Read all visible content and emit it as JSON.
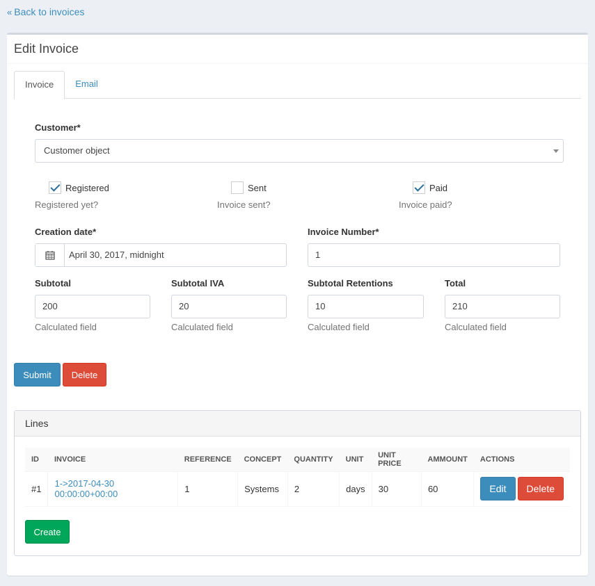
{
  "nav": {
    "back_label": "Back to invoices"
  },
  "box": {
    "title": "Edit Invoice"
  },
  "tabs": [
    {
      "label": "Invoice",
      "active": true
    },
    {
      "label": "Email",
      "active": false
    }
  ],
  "form": {
    "customer": {
      "label": "Customer*",
      "value": "Customer object"
    },
    "registered": {
      "label": "Registered",
      "checked": true,
      "help": "Registered yet?"
    },
    "sent": {
      "label": "Sent",
      "checked": false,
      "help": "Invoice sent?"
    },
    "paid": {
      "label": "Paid",
      "checked": true,
      "help": "Invoice paid?"
    },
    "creation_date": {
      "label": "Creation date*",
      "value": "April 30, 2017, midnight",
      "icon": "calendar-icon"
    },
    "invoice_number": {
      "label": "Invoice Number*",
      "value": "1"
    },
    "subtotal": {
      "label": "Subtotal",
      "value": "200",
      "help": "Calculated field"
    },
    "subtotal_iva": {
      "label": "Subtotal IVA",
      "value": "20",
      "help": "Calculated field"
    },
    "subtotal_retentions": {
      "label": "Subtotal Retentions",
      "value": "10",
      "help": "Calculated field"
    },
    "total": {
      "label": "Total",
      "value": "210",
      "help": "Calculated field"
    }
  },
  "buttons": {
    "submit": "Submit",
    "delete": "Delete",
    "create": "Create"
  },
  "lines": {
    "title": "Lines",
    "columns": [
      "ID",
      "INVOICE",
      "REFERENCE",
      "CONCEPT",
      "QUANTITY",
      "UNIT",
      "UNIT PRICE",
      "AMMOUNT",
      "ACTIONS"
    ],
    "rows": [
      {
        "id": "#1",
        "invoice": "1->2017-04-30 00:00:00+00:00",
        "reference": "1",
        "concept": "Systems",
        "quantity": "2",
        "unit": "days",
        "unit_price": "30",
        "ammount": "60",
        "edit_label": "Edit",
        "delete_label": "Delete"
      }
    ]
  },
  "colors": {
    "primary": "#3c8dbc",
    "danger": "#dd4b39",
    "success": "#00a65a",
    "check": "#2a6f97"
  }
}
